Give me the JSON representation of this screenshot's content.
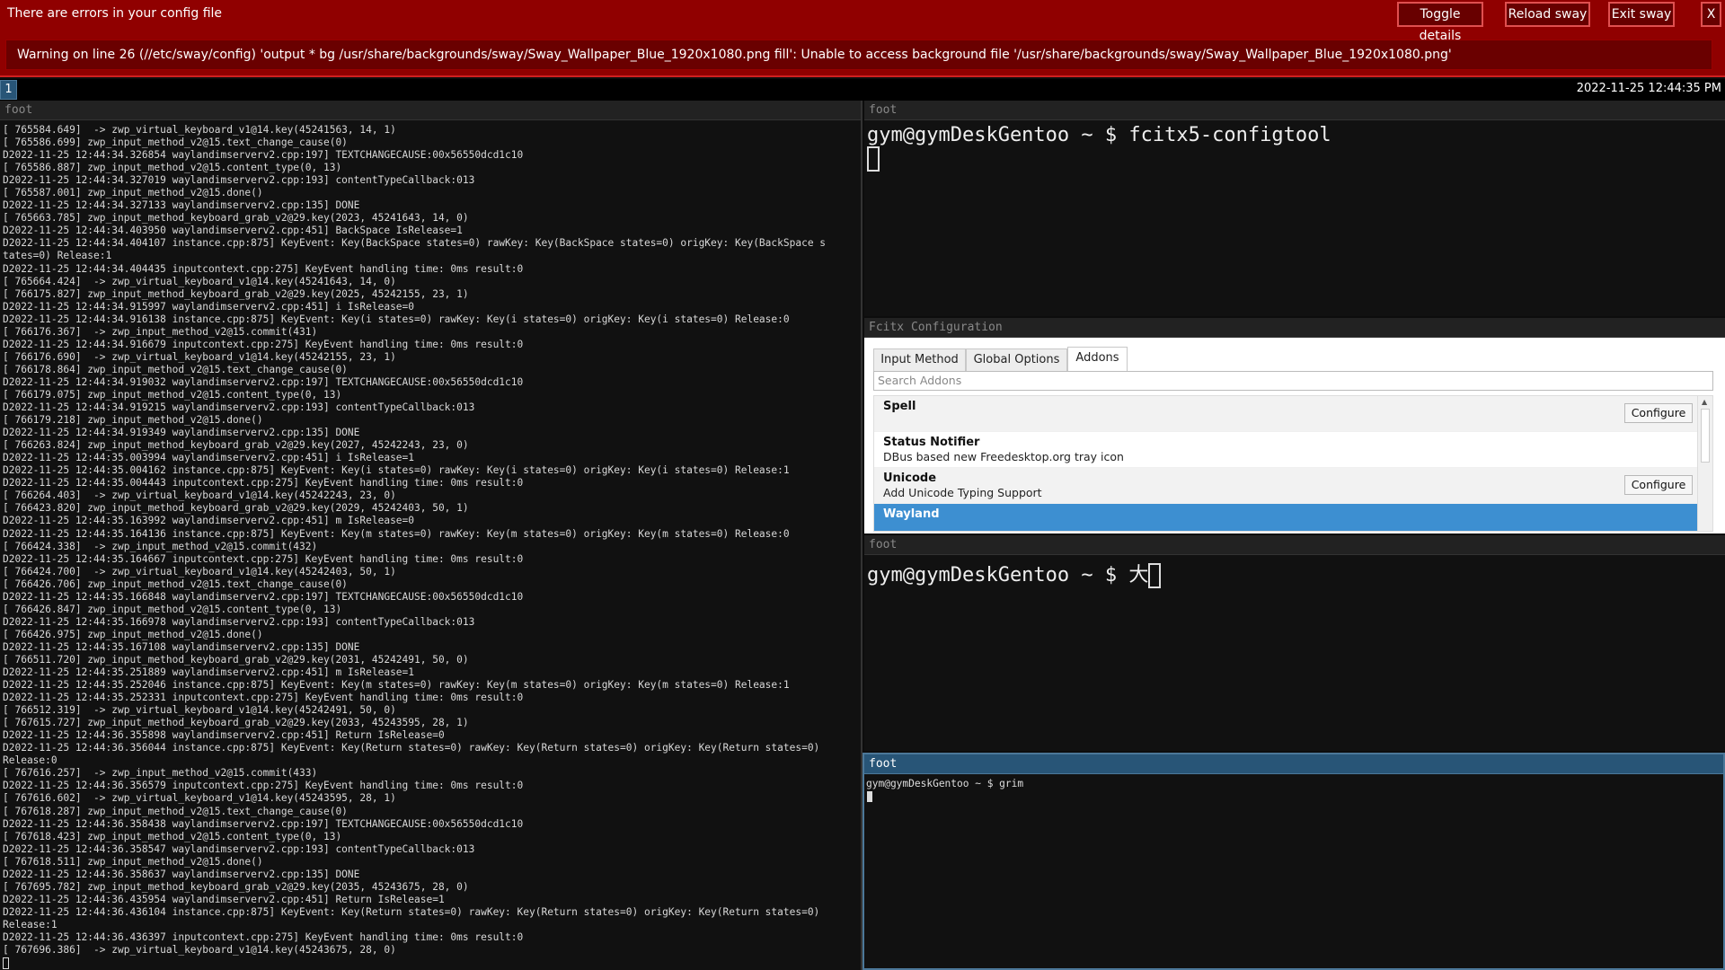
{
  "nag": {
    "message": "There are errors in your config file",
    "buttons": {
      "toggle": "Toggle details",
      "reload": "Reload sway",
      "exit": "Exit sway",
      "close": "X"
    },
    "detail": "Warning on line 26 (//etc/sway/config) 'output * bg /usr/share/backgrounds/sway/Sway_Wallpaper_Blue_1920x1080.png fill': Unable to access background file '/usr/share/backgrounds/sway/Sway_Wallpaper_Blue_1920x1080.png'",
    "colors": {
      "bg": "#900000",
      "border": "#d02020"
    }
  },
  "bar": {
    "workspace": "1",
    "clock": "2022-11-25 12:44:35 PM"
  },
  "log_window": {
    "title": "foot",
    "lines": [
      "[ 765584.649]  -> zwp_virtual_keyboard_v1@14.key(45241563, 14, 1)",
      "[ 765586.699] zwp_input_method_v2@15.text_change_cause(0)",
      "D2022-11-25 12:44:34.326854 waylandimserverv2.cpp:197] TEXTCHANGECAUSE:00x56550dcd1c10",
      "[ 765586.887] zwp_input_method_v2@15.content_type(0, 13)",
      "D2022-11-25 12:44:34.327019 waylandimserverv2.cpp:193] contentTypeCallback:013",
      "[ 765587.001] zwp_input_method_v2@15.done()",
      "D2022-11-25 12:44:34.327133 waylandimserverv2.cpp:135] DONE",
      "[ 765663.785] zwp_input_method_keyboard_grab_v2@29.key(2023, 45241643, 14, 0)",
      "D2022-11-25 12:44:34.403950 waylandimserverv2.cpp:451] BackSpace IsRelease=1",
      "D2022-11-25 12:44:34.404107 instance.cpp:875] KeyEvent: Key(BackSpace states=0) rawKey: Key(BackSpace states=0) origKey: Key(BackSpace s",
      "tates=0) Release:1",
      "D2022-11-25 12:44:34.404435 inputcontext.cpp:275] KeyEvent handling time: 0ms result:0",
      "[ 765664.424]  -> zwp_virtual_keyboard_v1@14.key(45241643, 14, 0)",
      "[ 766175.827] zwp_input_method_keyboard_grab_v2@29.key(2025, 45242155, 23, 1)",
      "D2022-11-25 12:44:34.915997 waylandimserverv2.cpp:451] i IsRelease=0",
      "D2022-11-25 12:44:34.916138 instance.cpp:875] KeyEvent: Key(i states=0) rawKey: Key(i states=0) origKey: Key(i states=0) Release:0",
      "[ 766176.367]  -> zwp_input_method_v2@15.commit(431)",
      "D2022-11-25 12:44:34.916679 inputcontext.cpp:275] KeyEvent handling time: 0ms result:0",
      "[ 766176.690]  -> zwp_virtual_keyboard_v1@14.key(45242155, 23, 1)",
      "[ 766178.864] zwp_input_method_v2@15.text_change_cause(0)",
      "D2022-11-25 12:44:34.919032 waylandimserverv2.cpp:197] TEXTCHANGECAUSE:00x56550dcd1c10",
      "[ 766179.075] zwp_input_method_v2@15.content_type(0, 13)",
      "D2022-11-25 12:44:34.919215 waylandimserverv2.cpp:193] contentTypeCallback:013",
      "[ 766179.218] zwp_input_method_v2@15.done()",
      "D2022-11-25 12:44:34.919349 waylandimserverv2.cpp:135] DONE",
      "[ 766263.824] zwp_input_method_keyboard_grab_v2@29.key(2027, 45242243, 23, 0)",
      "D2022-11-25 12:44:35.003994 waylandimserverv2.cpp:451] i IsRelease=1",
      "D2022-11-25 12:44:35.004162 instance.cpp:875] KeyEvent: Key(i states=0) rawKey: Key(i states=0) origKey: Key(i states=0) Release:1",
      "D2022-11-25 12:44:35.004443 inputcontext.cpp:275] KeyEvent handling time: 0ms result:0",
      "[ 766264.403]  -> zwp_virtual_keyboard_v1@14.key(45242243, 23, 0)",
      "[ 766423.820] zwp_input_method_keyboard_grab_v2@29.key(2029, 45242403, 50, 1)",
      "D2022-11-25 12:44:35.163992 waylandimserverv2.cpp:451] m IsRelease=0",
      "D2022-11-25 12:44:35.164136 instance.cpp:875] KeyEvent: Key(m states=0) rawKey: Key(m states=0) origKey: Key(m states=0) Release:0",
      "[ 766424.338]  -> zwp_input_method_v2@15.commit(432)",
      "D2022-11-25 12:44:35.164667 inputcontext.cpp:275] KeyEvent handling time: 0ms result:0",
      "[ 766424.700]  -> zwp_virtual_keyboard_v1@14.key(45242403, 50, 1)",
      "[ 766426.706] zwp_input_method_v2@15.text_change_cause(0)",
      "D2022-11-25 12:44:35.166848 waylandimserverv2.cpp:197] TEXTCHANGECAUSE:00x56550dcd1c10",
      "[ 766426.847] zwp_input_method_v2@15.content_type(0, 13)",
      "D2022-11-25 12:44:35.166978 waylandimserverv2.cpp:193] contentTypeCallback:013",
      "[ 766426.975] zwp_input_method_v2@15.done()",
      "D2022-11-25 12:44:35.167108 waylandimserverv2.cpp:135] DONE",
      "[ 766511.720] zwp_input_method_keyboard_grab_v2@29.key(2031, 45242491, 50, 0)",
      "D2022-11-25 12:44:35.251889 waylandimserverv2.cpp:451] m IsRelease=1",
      "D2022-11-25 12:44:35.252046 instance.cpp:875] KeyEvent: Key(m states=0) rawKey: Key(m states=0) origKey: Key(m states=0) Release:1",
      "D2022-11-25 12:44:35.252331 inputcontext.cpp:275] KeyEvent handling time: 0ms result:0",
      "[ 766512.319]  -> zwp_virtual_keyboard_v1@14.key(45242491, 50, 0)",
      "[ 767615.727] zwp_input_method_keyboard_grab_v2@29.key(2033, 45243595, 28, 1)",
      "D2022-11-25 12:44:36.355898 waylandimserverv2.cpp:451] Return IsRelease=0",
      "D2022-11-25 12:44:36.356044 instance.cpp:875] KeyEvent: Key(Return states=0) rawKey: Key(Return states=0) origKey: Key(Return states=0)",
      "Release:0",
      "[ 767616.257]  -> zwp_input_method_v2@15.commit(433)",
      "D2022-11-25 12:44:36.356579 inputcontext.cpp:275] KeyEvent handling time: 0ms result:0",
      "[ 767616.602]  -> zwp_virtual_keyboard_v1@14.key(45243595, 28, 1)",
      "[ 767618.287] zwp_input_method_v2@15.text_change_cause(0)",
      "D2022-11-25 12:44:36.358438 waylandimserverv2.cpp:197] TEXTCHANGECAUSE:00x56550dcd1c10",
      "[ 767618.423] zwp_input_method_v2@15.content_type(0, 13)",
      "D2022-11-25 12:44:36.358547 waylandimserverv2.cpp:193] contentTypeCallback:013",
      "[ 767618.511] zwp_input_method_v2@15.done()",
      "D2022-11-25 12:44:36.358637 waylandimserverv2.cpp:135] DONE",
      "[ 767695.782] zwp_input_method_keyboard_grab_v2@29.key(2035, 45243675, 28, 0)",
      "D2022-11-25 12:44:36.435954 waylandimserverv2.cpp:451] Return IsRelease=1",
      "D2022-11-25 12:44:36.436104 instance.cpp:875] KeyEvent: Key(Return states=0) rawKey: Key(Return states=0) origKey: Key(Return states=0)",
      "Release:1",
      "D2022-11-25 12:44:36.436397 inputcontext.cpp:275] KeyEvent handling time: 0ms result:0",
      "[ 767696.386]  -> zwp_virtual_keyboard_v1@14.key(45243675, 28, 0)"
    ]
  },
  "configtool_window": {
    "title": "foot",
    "prompt": "gym@gymDeskGentoo ~ $ fcitx5-configtool"
  },
  "fcitx_window": {
    "title": "Fcitx Configuration",
    "tabs": [
      "Input Method",
      "Global Options",
      "Addons"
    ],
    "active_tab": "Addons",
    "search_placeholder": "Search Addons",
    "addons": [
      {
        "name": "Spell",
        "desc": "",
        "configure": "Configure"
      },
      {
        "name": "Status Notifier",
        "desc": "DBus based new Freedesktop.org tray icon",
        "configure": ""
      },
      {
        "name": "Unicode",
        "desc": "Add Unicode Typing Support",
        "configure": "Configure"
      },
      {
        "name": "Wayland",
        "desc": "",
        "configure": ""
      }
    ],
    "selected_addon": "Wayland",
    "colors": {
      "selection": "#3d8fd1"
    }
  },
  "ime_window": {
    "title": "foot",
    "prompt": "gym@gymDeskGentoo ~ $ 大"
  },
  "grim_window": {
    "title": "foot",
    "prompt": "gym@gymDeskGentoo ~ $ grim",
    "colors": {
      "focused_border": "#4c7899",
      "focused_title": "#285577"
    }
  }
}
